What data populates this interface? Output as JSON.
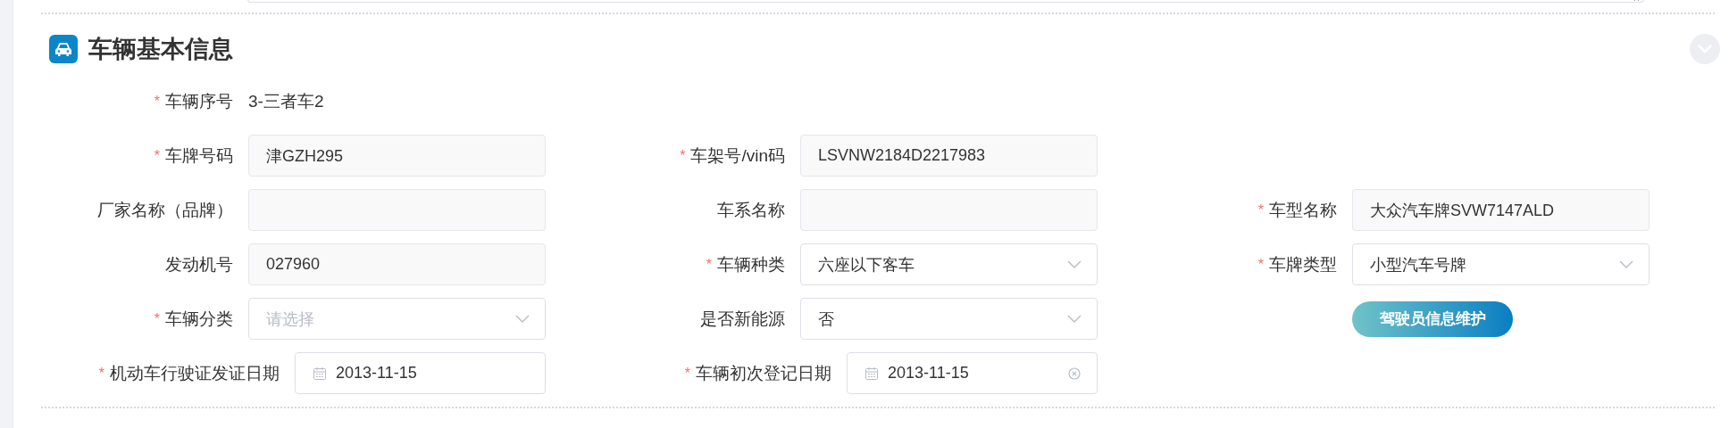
{
  "section": {
    "title": "车辆基本信息",
    "expanded": true
  },
  "rows": [
    {
      "fields": [
        {
          "kind": "text",
          "label": "车辆序号",
          "required_mark": "*",
          "value": "3-三者车2"
        }
      ]
    },
    {
      "fields": [
        {
          "kind": "input",
          "label": "车牌号码",
          "required_mark": "*",
          "value": "津GZH295"
        },
        {
          "kind": "input",
          "label": "车架号/vin码",
          "required_mark": "*",
          "value": "LSVNW2184D2217983"
        }
      ]
    },
    {
      "fields": [
        {
          "kind": "input",
          "label": "厂家名称（品牌）"
        },
        {
          "kind": "input",
          "label": "车系名称"
        },
        {
          "kind": "input",
          "label": "车型名称",
          "required_mark": "*",
          "value": "大众汽车牌SVW7147ALD"
        }
      ]
    },
    {
      "fields": [
        {
          "kind": "input",
          "label": "发动机号",
          "value": "027960"
        },
        {
          "kind": "select",
          "label": "车辆种类",
          "required_mark": "*",
          "value": "六座以下客车"
        },
        {
          "kind": "select",
          "label": "车牌类型",
          "required_mark": "*",
          "value": "小型汽车号牌"
        }
      ]
    },
    {
      "fields": [
        {
          "kind": "select",
          "label": "车辆分类",
          "required_mark": "*",
          "placeholder": "请选择"
        },
        {
          "kind": "select",
          "label": "是否新能源",
          "value": "否"
        },
        {
          "kind": "button",
          "label": "驾驶员信息维护"
        }
      ]
    },
    {
      "fields": [
        {
          "kind": "date",
          "label": "机动车行驶证发证日期",
          "required_mark": "*",
          "value": "2013-11-15",
          "clear_button": false
        },
        {
          "kind": "date",
          "label": "车辆初次登记日期",
          "required_mark": "*",
          "value": "2013-11-15",
          "clear_button": true
        }
      ]
    }
  ]
}
